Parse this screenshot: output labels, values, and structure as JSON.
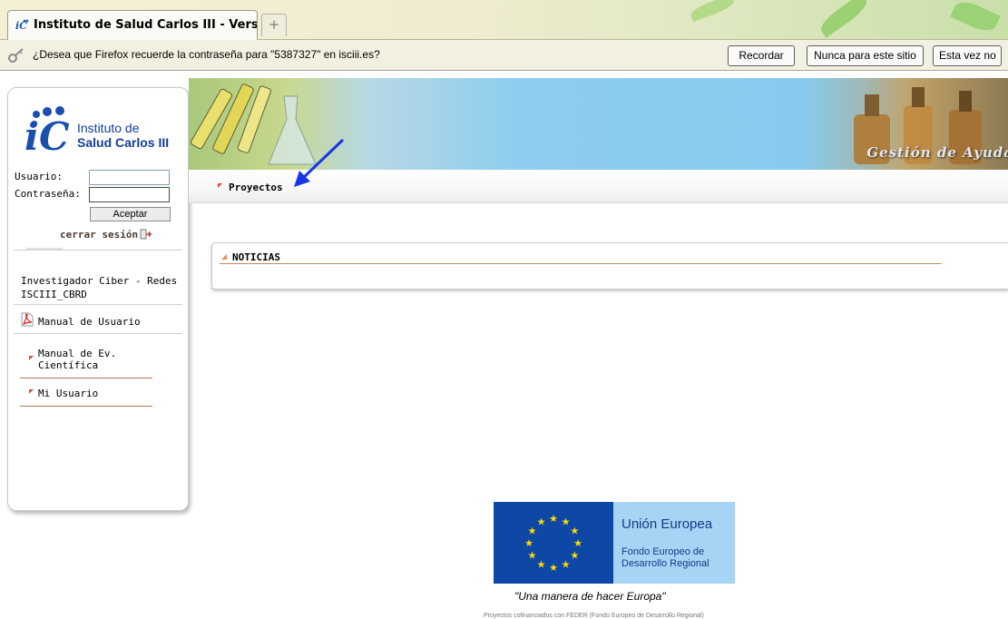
{
  "browser": {
    "tab_title": "Instituto de Salud Carlos III - Versió...",
    "new_tab_symbol": "+",
    "notification": {
      "text": "¿Desea que Firefox recuerde la contraseña para \"5387327\" en isciii.es?",
      "buttons": [
        "Recordar",
        "Nunca para este sitio",
        "Esta vez no"
      ]
    }
  },
  "sidebar": {
    "logo_line1": "Instituto de",
    "logo_line2": "Salud Carlos III",
    "usuario_label": "Usuario:",
    "password_label": "Contraseña:",
    "usuario_value": "",
    "password_value": "",
    "aceptar_label": "Aceptar",
    "cerrar_sesion": "cerrar sesión",
    "user_role": "Investigador Ciber - Redes",
    "user_code": "ISCIII_CBRD",
    "items": [
      {
        "label": "Manual de Usuario"
      },
      {
        "label": "Manual de Ev. Científica"
      },
      {
        "label": "Mi Usuario"
      }
    ]
  },
  "banner": {
    "title": "Gestión de Ayuda"
  },
  "main": {
    "menu_item": "Proyectos",
    "noticias_title": "NOTICIAS"
  },
  "footer": {
    "eu_title": "Unión Europea",
    "eu_fund_line1": "Fondo Europeo de",
    "eu_fund_line2": "Desarrollo Regional",
    "motto": "\"Una manera de hacer Europa\"",
    "cofinance_note": "Proyectos cofinanciados con FEDER (Fondo Europeo de Desarrollo Regional)"
  },
  "colors": {
    "accent_brown": "#b3765c",
    "annotation_arrow": "#1a35e6",
    "eu_blue": "#0f47a6",
    "eu_star": "#ffdd00"
  }
}
